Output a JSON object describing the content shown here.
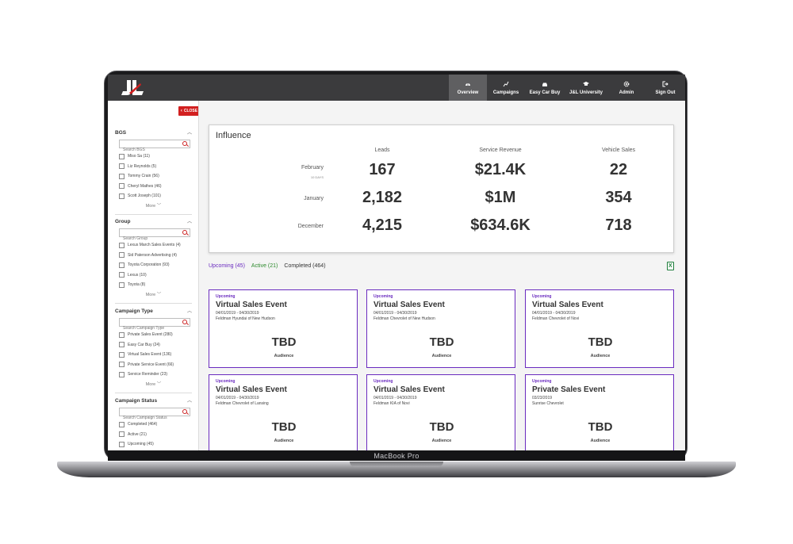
{
  "device": {
    "brand": "MacBook Pro"
  },
  "nav": [
    {
      "label": "Overview",
      "icon": "dashboard-icon",
      "active": true
    },
    {
      "label": "Campaigns",
      "icon": "chart-icon"
    },
    {
      "label": "Easy Car Buy",
      "icon": "car-icon"
    },
    {
      "label": "J&L University",
      "icon": "graduation-cap-icon"
    },
    {
      "label": "Admin",
      "icon": "gear-icon"
    },
    {
      "label": "Sign Out",
      "icon": "sign-out-icon"
    }
  ],
  "sidebar": {
    "close_label": "CLOSE",
    "more_label": "More",
    "sections": [
      {
        "title": "BGS",
        "placeholder": "Search BGS",
        "items": [
          "Miso Sa (11)",
          "Liz Reynolds (5)",
          "Tommy Crain (56)",
          "Cheryl Mathes (46)",
          "Scott Joseph (101)"
        ]
      },
      {
        "title": "Group",
        "placeholder": "Search Group",
        "items": [
          "Lexus March Sales Events (4)",
          "Sid Paterson Advertising (4)",
          "Toyota Corporation (93)",
          "Lexus (10)",
          "Toyota (8)"
        ]
      },
      {
        "title": "Campaign Type",
        "placeholder": "Search Campaign Type",
        "items": [
          "Private Sales Event (280)",
          "Easy Car Buy (24)",
          "Virtual Sales Event (136)",
          "Private Service Event (66)",
          "Service Reminder (23)"
        ]
      },
      {
        "title": "Campaign Status",
        "placeholder": "Search Campaign Status",
        "items": [
          "Completed (464)",
          "Active (21)",
          "Upcoming (45)"
        ]
      }
    ]
  },
  "influence": {
    "title": "Influence",
    "columns": [
      "Leads",
      "Service Revenue",
      "Vehicle Sales"
    ],
    "rows": [
      {
        "label": "February",
        "sublabel": "10 DAYS",
        "values": [
          "167",
          "$21.4K",
          "22"
        ]
      },
      {
        "label": "January",
        "sublabel": "",
        "values": [
          "2,182",
          "$1M",
          "354"
        ]
      },
      {
        "label": "December",
        "sublabel": "",
        "values": [
          "4,215",
          "$634.6K",
          "718"
        ]
      }
    ]
  },
  "tabs": {
    "upcoming": "Upcoming (45)",
    "active": "Active (21)",
    "completed": "Completed (464)"
  },
  "campaigns": [
    {
      "status": "Upcoming",
      "title": "Virtual Sales Event",
      "dates": "04/01/2019 - 04/30/2019",
      "dealer": "Feldman Hyundai of New Hudson",
      "value": "TBD",
      "label": "Audience"
    },
    {
      "status": "Upcoming",
      "title": "Virtual Sales Event",
      "dates": "04/01/2019 - 04/30/2019",
      "dealer": "Feldman Chevrolet of New Hudson",
      "value": "TBD",
      "label": "Audience"
    },
    {
      "status": "Upcoming",
      "title": "Virtual Sales Event",
      "dates": "04/01/2019 - 04/30/2019",
      "dealer": "Feldman Chevrolet of Novi",
      "value": "TBD",
      "label": "Audience"
    },
    {
      "status": "Upcoming",
      "title": "Virtual Sales Event",
      "dates": "04/01/2019 - 04/30/2019",
      "dealer": "Feldman Chevrolet of Lansing",
      "value": "TBD",
      "label": "Audience"
    },
    {
      "status": "Upcoming",
      "title": "Virtual Sales Event",
      "dates": "04/01/2019 - 04/30/2019",
      "dealer": "Feldman KIA of Novi",
      "value": "TBD",
      "label": "Audience"
    },
    {
      "status": "Upcoming",
      "title": "Private Sales Event",
      "dates": "03/23/2019",
      "dealer": "Sunrise Chevrolet",
      "value": "TBD",
      "label": "Audience"
    }
  ],
  "colors": {
    "accent_purple": "#6a2bbf",
    "active_green": "#2c8a2c",
    "close_red": "#d22020",
    "topbar": "#3b3b3d"
  }
}
